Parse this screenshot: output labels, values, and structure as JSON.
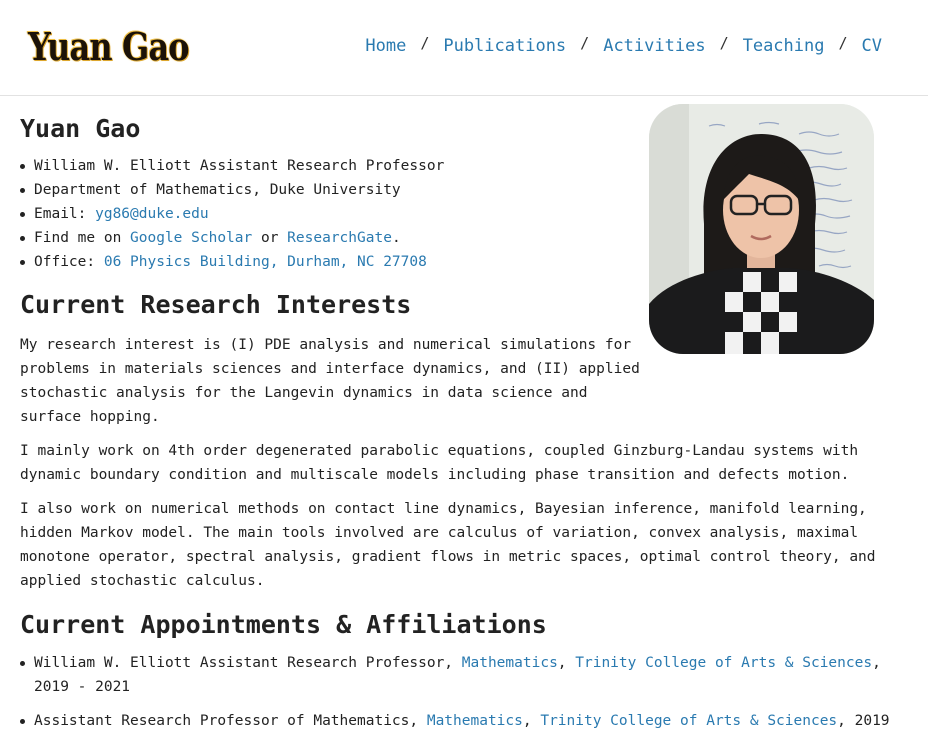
{
  "header": {
    "logo": "Yuan Gao",
    "nav": [
      "Home",
      "Publications",
      "Activities",
      "Teaching",
      "CV"
    ],
    "separator": "/"
  },
  "profile": {
    "name": "Yuan Gao",
    "title": "William W. Elliott Assistant Research Professor",
    "department": "Department of Mathematics, Duke University",
    "email_label": "Email: ",
    "email": "yg86@duke.edu",
    "find_me_prefix": "Find me on ",
    "scholar": "Google Scholar",
    "find_me_or": " or ",
    "researchgate": "ResearchGate",
    "find_me_suffix": ".",
    "office_label": "Office: ",
    "office": "06 Physics Building, Durham, NC 27708"
  },
  "research": {
    "heading": "Current Research Interests",
    "paragraphs": [
      "My research interest is (I) PDE analysis and numerical simulations for problems in materials sciences and interface dynamics, and (II) applied stochastic analysis for the Langevin dynamics in data science and surface hopping.",
      "I mainly work on 4th order degenerated parabolic equations, coupled Ginzburg-Landau systems with dynamic boundary condition and multiscale models including phase transition and defects motion.",
      "I also work on numerical methods on contact line dynamics, Bayesian inference, manifold learning, hidden Markov model. The main tools involved are calculus of variation, convex analysis, maximal monotone operator, spectral analysis, gradient flows in metric spaces, optimal control theory, and applied stochastic calculus."
    ]
  },
  "appointments": {
    "heading": "Current Appointments & Affiliations",
    "items": [
      {
        "role": "William W. Elliott Assistant Research Professor, ",
        "dept": "Mathematics",
        "comma": ", ",
        "school": "Trinity College of Arts & Sciences",
        "years": ", 2019 - 2021"
      },
      {
        "role": "Assistant Research Professor of Mathematics, ",
        "dept": "Mathematics",
        "comma": ", ",
        "school": "Trinity College of Arts & Sciences",
        "years": ", 2019"
      }
    ]
  },
  "colors": {
    "link": "#2a7ab0",
    "text": "#222222",
    "logo_gold": "#d9a22a"
  }
}
